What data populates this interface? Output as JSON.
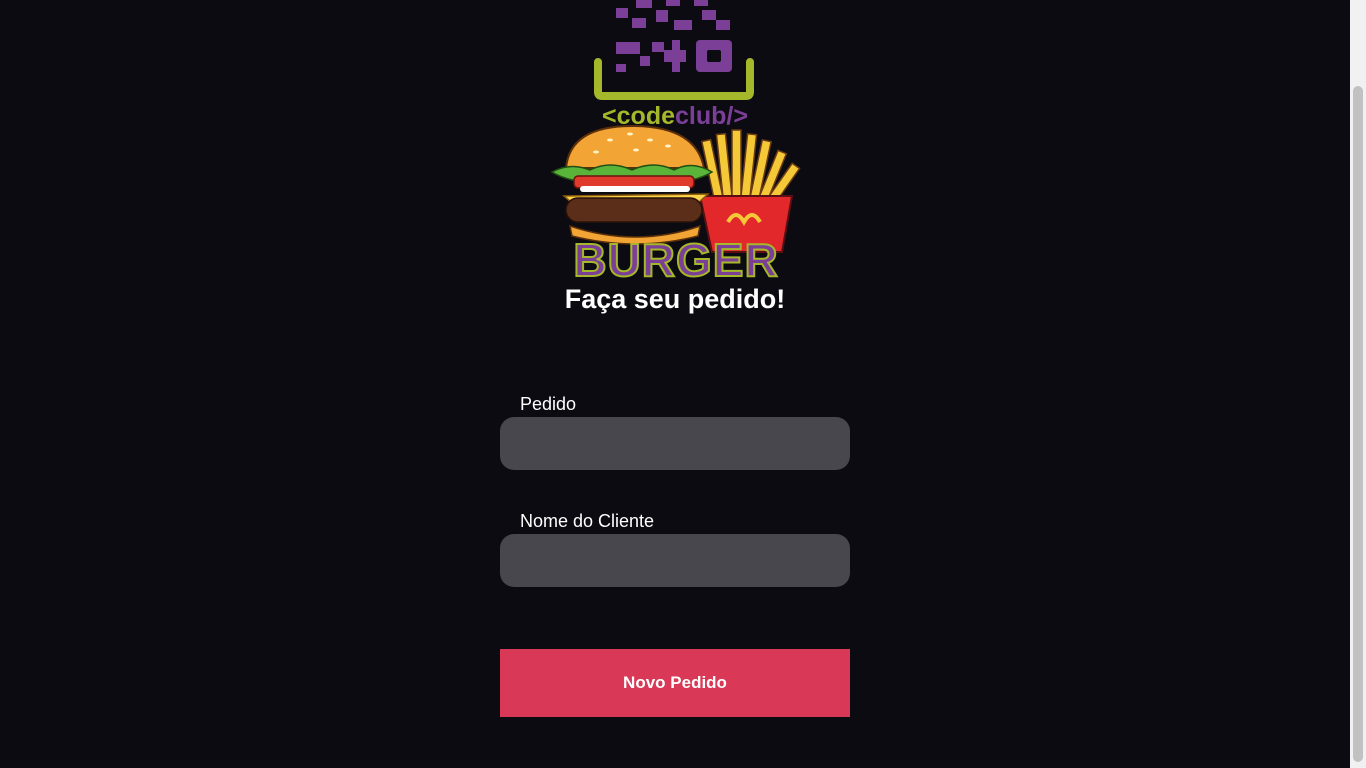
{
  "logo": {
    "brand_text_open": "<code",
    "brand_text_club": "club/>",
    "burger_text": "BURGER",
    "colors": {
      "purple": "#7b3f97",
      "lime": "#a5b72a",
      "bun": "#f2a435",
      "fries": "#f5c838",
      "fries_box": "#e3282b"
    }
  },
  "header": {
    "title": "Faça seu pedido!"
  },
  "form": {
    "order_label": "Pedido",
    "order_value": "",
    "customer_label": "Nome do Cliente",
    "customer_value": "",
    "submit_label": "Novo Pedido"
  },
  "colors": {
    "background": "#0c0b12",
    "input_background": "#48474d",
    "button": "#d93856"
  }
}
